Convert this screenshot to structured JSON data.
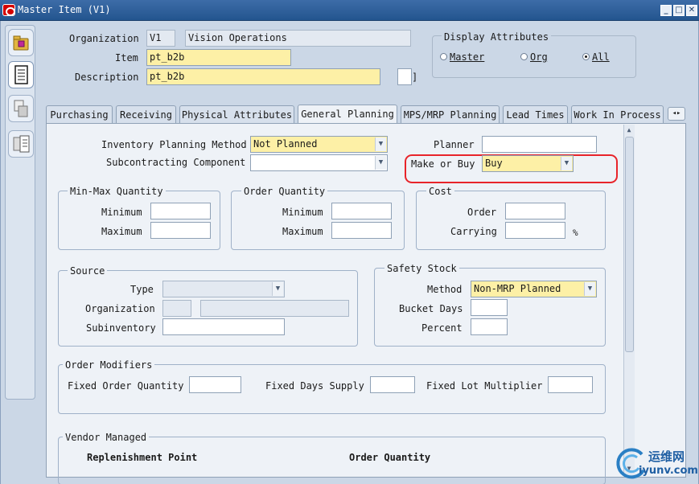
{
  "window": {
    "title": "Master Item (V1)",
    "minimize": "_",
    "maximize": "□",
    "close": "✕"
  },
  "header": {
    "organization_label": "Organization",
    "organization_code": "V1",
    "organization_name": "Vision Operations",
    "item_label": "Item",
    "item_value": "pt_b2b",
    "description_label": "Description",
    "description_value": "pt_b2b",
    "bracket": "]"
  },
  "display_attributes": {
    "title": "Display Attributes",
    "options": [
      {
        "label": "Master",
        "selected": false
      },
      {
        "label": "Org",
        "selected": false
      },
      {
        "label": "All",
        "selected": true
      }
    ]
  },
  "tabs": [
    {
      "label": "Purchasing",
      "active": false
    },
    {
      "label": "Receiving",
      "active": false
    },
    {
      "label": "Physical Attributes",
      "active": false
    },
    {
      "label": "General Planning",
      "active": true
    },
    {
      "label": "MPS/MRP Planning",
      "active": false
    },
    {
      "label": "Lead Times",
      "active": false
    },
    {
      "label": "Work In Process",
      "active": false
    }
  ],
  "tab_scroll": "◂▸",
  "general_planning": {
    "inventory_planning_method_label": "Inventory Planning Method",
    "inventory_planning_method_value": "Not Planned",
    "subcontracting_component_label": "Subcontracting Component",
    "subcontracting_component_value": "",
    "planner_label": "Planner",
    "planner_value": "",
    "make_or_buy_label": "Make or Buy",
    "make_or_buy_value": "Buy",
    "min_max": {
      "title": "Min-Max Quantity",
      "minimum_label": "Minimum",
      "maximum_label": "Maximum",
      "minimum": "",
      "maximum": ""
    },
    "order_quantity": {
      "title": "Order Quantity",
      "minimum_label": "Minimum",
      "maximum_label": "Maximum",
      "minimum": "",
      "maximum": ""
    },
    "cost": {
      "title": "Cost",
      "order_label": "Order",
      "carrying_label": "Carrying",
      "order": "",
      "carrying": "",
      "percent_sign": "%"
    },
    "source": {
      "title": "Source",
      "type_label": "Type",
      "organization_label": "Organization",
      "subinventory_label": "Subinventory",
      "type": "",
      "organization": "",
      "subinventory": ""
    },
    "safety_stock": {
      "title": "Safety Stock",
      "method_label": "Method",
      "method_value": "Non-MRP Planned",
      "bucket_days_label": "Bucket Days",
      "percent_label": "Percent",
      "bucket_days": "",
      "percent": ""
    },
    "order_modifiers": {
      "title": "Order Modifiers",
      "fixed_order_quantity_label": "Fixed Order Quantity",
      "fixed_days_supply_label": "Fixed Days Supply",
      "fixed_lot_multiplier_label": "Fixed Lot Multiplier"
    },
    "vendor_managed": {
      "title": "Vendor Managed",
      "replenishment_point": "Replenishment Point",
      "order_quantity": "Order Quantity"
    }
  },
  "colors": {
    "highlight": "#e8242a",
    "required_field": "#fdf0a6",
    "titlebar": "#2f5f9c"
  },
  "watermark": {
    "text": "运维网",
    "subtext": "iyunv.com"
  }
}
